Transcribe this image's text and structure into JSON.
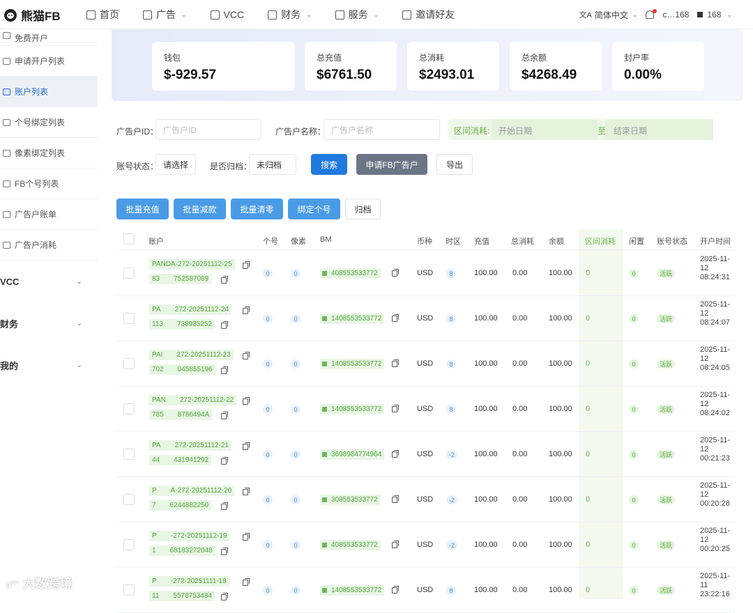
{
  "app": {
    "name": "熊猫FB"
  },
  "nav": {
    "items": [
      {
        "label": "首页",
        "icon": "home-icon",
        "has_dropdown": false
      },
      {
        "label": "广告",
        "icon": "ad-icon",
        "has_dropdown": true
      },
      {
        "label": "VCC",
        "icon": "card-icon",
        "has_dropdown": false
      },
      {
        "label": "财务",
        "icon": "finance-icon",
        "has_dropdown": true
      },
      {
        "label": "服务",
        "icon": "service-icon",
        "has_dropdown": true
      },
      {
        "label": "邀请好友",
        "icon": "gift-icon",
        "has_dropdown": false
      }
    ],
    "language": "简体中文",
    "user": "c…168",
    "account": "168"
  },
  "sidebar": {
    "items": [
      {
        "label": "免费开户",
        "active": false
      },
      {
        "label": "申请开户列表",
        "active": false
      },
      {
        "label": "账户列表",
        "active": true
      },
      {
        "label": "个号绑定列表",
        "active": false
      },
      {
        "label": "像素绑定列表",
        "active": false
      },
      {
        "label": "FB个号列表",
        "active": false
      },
      {
        "label": "广告户账单",
        "active": false
      },
      {
        "label": "广告户消耗",
        "active": false
      }
    ],
    "groups": [
      "VCC",
      "财务",
      "我的"
    ]
  },
  "stats": [
    {
      "label": "钱包",
      "value": "$-929.57"
    },
    {
      "label": "总充值",
      "value": "$6761.50"
    },
    {
      "label": "总消耗",
      "value": "$2493.01"
    },
    {
      "label": "总余额",
      "value": "$4268.49"
    },
    {
      "label": "封户率",
      "value": "0.00%"
    }
  ],
  "filters": {
    "ad_account_id_label": "广告户ID：",
    "ad_account_id_placeholder": "广告户ID",
    "ad_account_name_label": "广告户名称：",
    "ad_account_name_placeholder": "广告户名称",
    "range_label": "区间消耗:",
    "start_placeholder": "开始日期",
    "range_sep": "至",
    "end_placeholder": "结束日期",
    "status_label": "账号状态：",
    "status_value": "请选择",
    "archived_label": "是否归档：",
    "archived_value": "未归档",
    "search_button": "搜索",
    "apply_button": "申请FB广告户",
    "export_button": "导出"
  },
  "batch_actions": [
    "批量充值",
    "批量减款",
    "批量清零",
    "绑定个号",
    "归档"
  ],
  "table": {
    "headers": [
      "账户",
      "个号",
      "像素",
      "BM",
      "币种",
      "时区",
      "充值",
      "总消耗",
      "余额",
      "区间消耗",
      "闲置",
      "账号状态",
      "开户时间"
    ],
    "rows": [
      {
        "name": "PANDA-272-20251112-25",
        "id": "83  752587089",
        "personal": "0",
        "pixel": "0",
        "bm": "408553533772",
        "currency": "USD",
        "tz": "8",
        "recharge": "100.00",
        "spent": "0.00",
        "balance": "100.00",
        "range": "0",
        "idle": "0",
        "status": "活跃",
        "date": "2025-11-12",
        "time": "08:24:31"
      },
      {
        "name": "PA  272-20251112-24",
        "id": "113  738935252",
        "personal": "0",
        "pixel": "0",
        "bm": "1408553533772",
        "currency": "USD",
        "tz": "8",
        "recharge": "100.00",
        "spent": "0.00",
        "balance": "100.00",
        "range": "0",
        "idle": "0",
        "status": "活跃",
        "date": "2025-11-12",
        "time": "08:24:07"
      },
      {
        "name": "PAI  272-20251112-23",
        "id": "702  045855196",
        "personal": "0",
        "pixel": "0",
        "bm": "1408553533772",
        "currency": "USD",
        "tz": "8",
        "recharge": "100.00",
        "spent": "0.00",
        "balance": "100.00",
        "range": "0",
        "idle": "0",
        "status": "活跃",
        "date": "2025-11-12",
        "time": "08:24:05"
      },
      {
        "name": "PAN  272-20251112-22",
        "id": "785  8786494A",
        "personal": "0",
        "pixel": "0",
        "bm": "1408553533772",
        "currency": "USD",
        "tz": "8",
        "recharge": "100.00",
        "spent": "0.00",
        "balance": "100.00",
        "range": "0",
        "idle": "0",
        "status": "活跃",
        "date": "2025-11-12",
        "time": "08:24:02"
      },
      {
        "name": "PA  272-20251112-21",
        "id": "44  431941292",
        "personal": "0",
        "pixel": "0",
        "bm": "3698984774964",
        "currency": "USD",
        "tz": "-2",
        "recharge": "100.00",
        "spent": "0.00",
        "balance": "100.00",
        "range": "0",
        "idle": "0",
        "status": "活跃",
        "date": "2025-11-12",
        "time": "00:21:23"
      },
      {
        "name": "P  A-272-20251112-20",
        "id": "7  6244882250",
        "personal": "0",
        "pixel": "0",
        "bm": "308553533772",
        "currency": "USD",
        "tz": "-2",
        "recharge": "100.00",
        "spent": "0.00",
        "balance": "100.00",
        "range": "0",
        "idle": "0",
        "status": "活跃",
        "date": "2025-11-12",
        "time": "00:20:28"
      },
      {
        "name": "P  -272-20251112-19",
        "id": "1  68183272048",
        "personal": "0",
        "pixel": "0",
        "bm": "408553533772",
        "currency": "USD",
        "tz": "-2",
        "recharge": "100.00",
        "spent": "0.00",
        "balance": "100.00",
        "range": "0",
        "idle": "0",
        "status": "活跃",
        "date": "2025-11-12",
        "time": "00:20:25"
      },
      {
        "name": "P  -272-20251111-18",
        "id": "11  5578753484",
        "personal": "0",
        "pixel": "0",
        "bm": "1408553533772",
        "currency": "USD",
        "tz": "8",
        "recharge": "100.00",
        "spent": "0.00",
        "balance": "100.00",
        "range": "0",
        "idle": "0",
        "status": "活跃",
        "date": "2025-11-11",
        "time": "23:22:16"
      }
    ]
  },
  "watermark": "大数跨境",
  "colors": {
    "primary": "#1f7ae0",
    "success": "#52a33a",
    "active_menu": "#2d6fd6"
  }
}
